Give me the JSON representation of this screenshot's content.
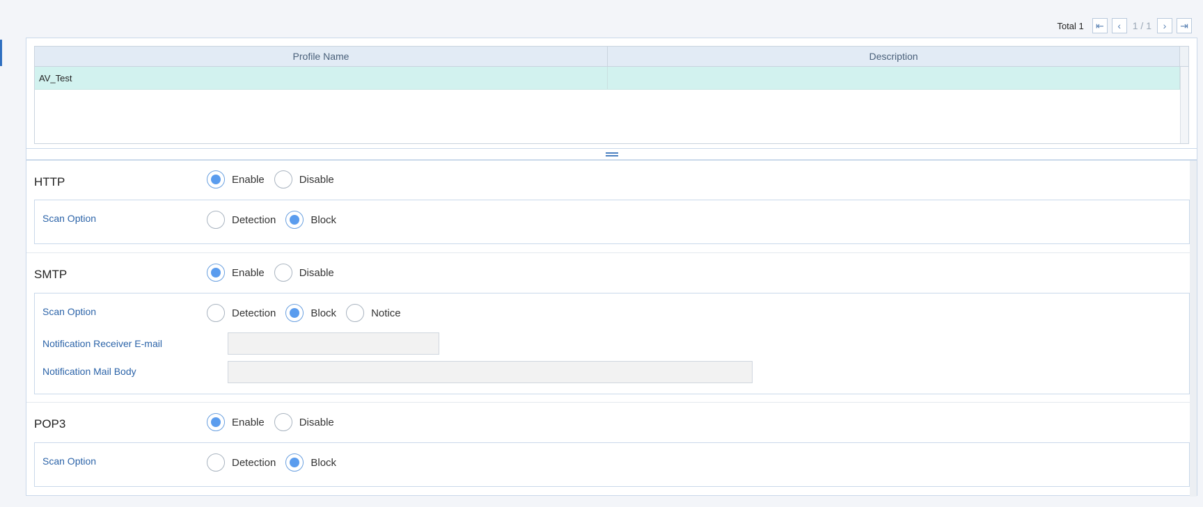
{
  "pager": {
    "total_label": "Total 1",
    "page_info": "1 / 1",
    "first_icon": "first-page-icon",
    "prev_icon": "prev-page-icon",
    "next_icon": "next-page-icon",
    "last_icon": "last-page-icon"
  },
  "grid": {
    "columns": [
      "Profile Name",
      "Description"
    ],
    "rows": [
      {
        "profile_name": "AV_Test",
        "description": ""
      }
    ]
  },
  "sections": {
    "http": {
      "title": "HTTP",
      "status_options": [
        "Enable",
        "Disable"
      ],
      "status_selected": "Enable",
      "scan_option_label": "Scan Option",
      "scan_options": [
        "Detection",
        "Block"
      ],
      "scan_selected": "Block"
    },
    "smtp": {
      "title": "SMTP",
      "status_options": [
        "Enable",
        "Disable"
      ],
      "status_selected": "Enable",
      "scan_option_label": "Scan Option",
      "scan_options": [
        "Detection",
        "Block",
        "Notice"
      ],
      "scan_selected": "Block",
      "receiver_label": "Notification Receiver E-mail",
      "receiver_value": "",
      "mail_body_label": "Notification Mail Body",
      "mail_body_value": ""
    },
    "pop3": {
      "title": "POP3",
      "status_options": [
        "Enable",
        "Disable"
      ],
      "status_selected": "Enable",
      "scan_option_label": "Scan Option",
      "scan_options": [
        "Detection",
        "Block"
      ],
      "scan_selected": "Block"
    }
  },
  "colors": {
    "accent": "#5a9cee",
    "selected_row": "#d2f2ef",
    "header_bg": "#e2ebf5",
    "label_blue": "#2b63a8"
  }
}
